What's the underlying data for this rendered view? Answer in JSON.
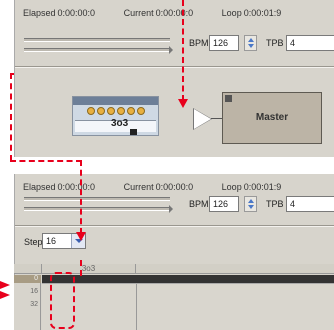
{
  "top_panel": {
    "elapsed_label": "Elapsed",
    "elapsed_value": "0:00:00:0",
    "current_label": "Current",
    "current_value": "0:00:00:0",
    "loop_label": "Loop",
    "loop_value": "0:00:01:9",
    "bpm_label": "BPM",
    "bpm_value": "126",
    "tpb_label": "TPB",
    "tpb_value": "4"
  },
  "machines": {
    "generator_name": "3o3",
    "master_name": "Master"
  },
  "bottom_panel": {
    "elapsed_label": "Elapsed",
    "elapsed_value": "0:00:00:0",
    "current_label": "Current",
    "current_value": "0:00:00:0",
    "loop_label": "Loop",
    "loop_value": "0:00:01:9",
    "bpm_label": "BPM",
    "bpm_value": "126",
    "tpb_label": "TPB",
    "tpb_value": "4",
    "step_label": "Step",
    "step_value": "16"
  },
  "pattern": {
    "track_name": "3o3",
    "row_numbers": [
      "0",
      "16",
      "32"
    ]
  },
  "colors": {
    "annotation": "#e8001c",
    "panel": "#d7d4cc",
    "active_row": "#333333"
  },
  "icons": {
    "spin": "spin-updown-icon",
    "dropdown": "chevron-down-icon"
  }
}
